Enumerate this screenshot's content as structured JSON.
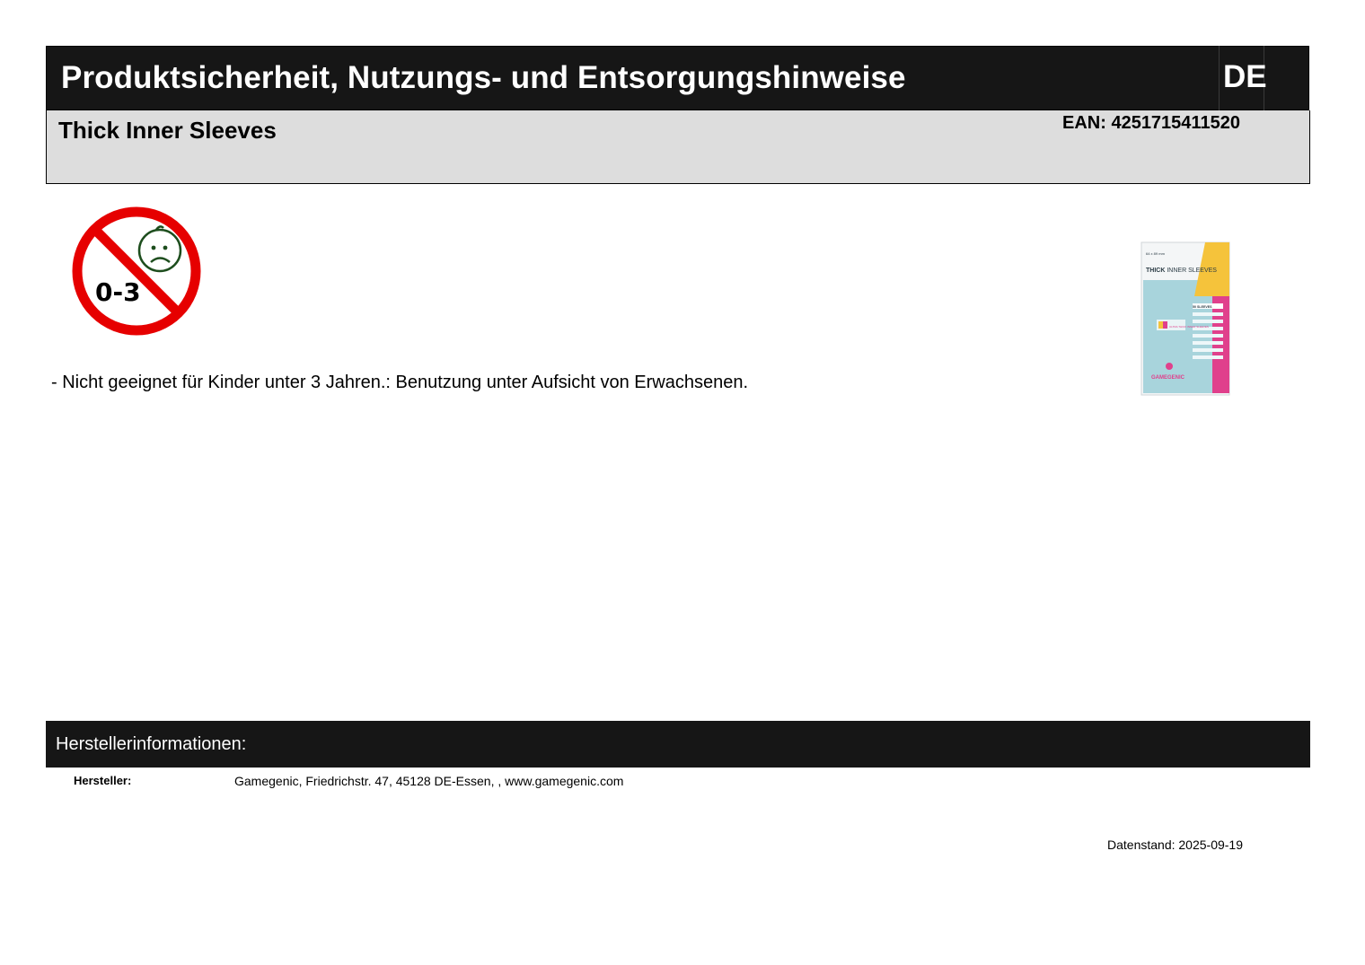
{
  "header": {
    "title": "Produktsicherheit, Nutzungs- und Entsorgungshinweise",
    "language_code": "DE"
  },
  "product": {
    "name": "Thick Inner Sleeves",
    "ean": "EAN: 4251715411520"
  },
  "age_warning_icon": {
    "icon": "not-for-children-under-3-icon",
    "age_range": "0-3",
    "color": "#e60000"
  },
  "warning_text": "- Nicht geeignet für Kinder unter 3 Jahren.: Benutzung unter Aufsicht von Erwachsenen.",
  "product_image": {
    "brand": "GAMEGENIC",
    "headline_bold": "THICK",
    "headline_light": "INNER SLEEVES",
    "badge": "ULTRA THICK INNER SLEEVES",
    "count": "50 SLEEVES",
    "size": "64 x 89 mm",
    "colors": {
      "front": "#a8d4dc",
      "accent_yellow": "#f5c33b",
      "accent_pink": "#e0408c"
    }
  },
  "manufacturer": {
    "heading": "Herstellerinformationen:",
    "label": "Hersteller:",
    "value": "Gamegenic, Friedrichstr. 47, 45128 DE-Essen, , www.gamegenic.com"
  },
  "footer": {
    "data_date": "Datenstand: 2025-09-19"
  }
}
